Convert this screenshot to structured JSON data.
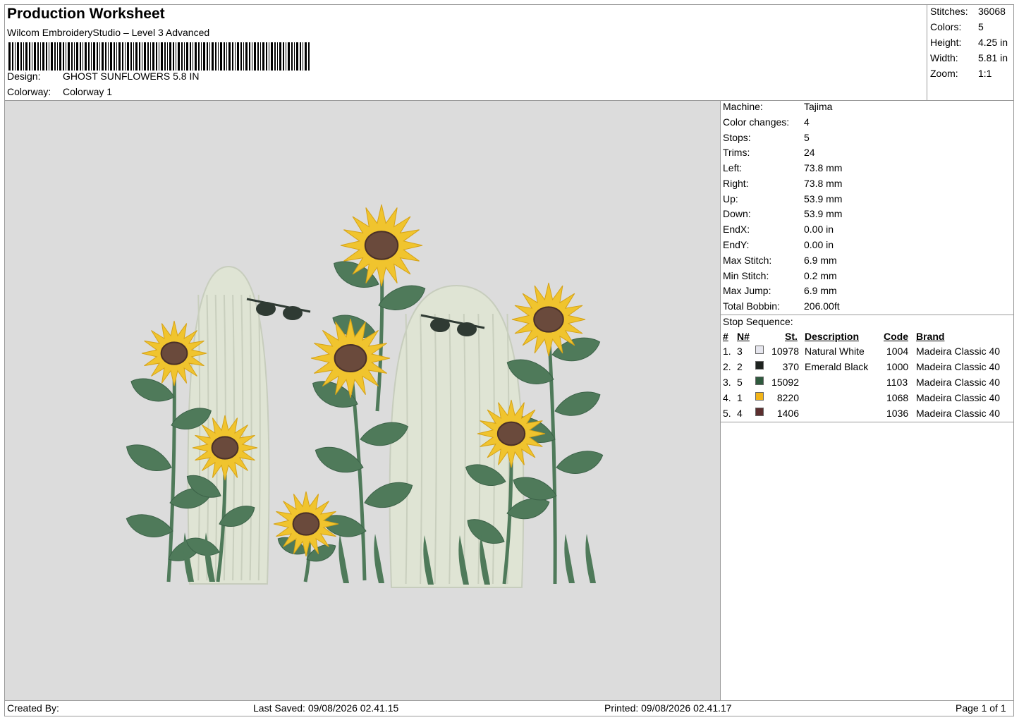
{
  "header": {
    "title": "Production Worksheet",
    "software": "Wilcom EmbroideryStudio – Level 3 Advanced",
    "design_label": "Design:",
    "design_value": "GHOST SUNFLOWERS 5.8 IN",
    "colorway_label": "Colorway:",
    "colorway_value": "Colorway 1"
  },
  "summary": [
    {
      "label": "Stitches:",
      "value": "36068"
    },
    {
      "label": "Colors:",
      "value": "5"
    },
    {
      "label": "Height:",
      "value": "4.25 in"
    },
    {
      "label": "Width:",
      "value": "5.81 in"
    },
    {
      "label": "Zoom:",
      "value": "1:1"
    }
  ],
  "machine_info": [
    {
      "label": "Machine:",
      "value": "Tajima"
    },
    {
      "label": "Color changes:",
      "value": "4"
    },
    {
      "label": "Stops:",
      "value": "5"
    },
    {
      "label": "Trims:",
      "value": "24"
    },
    {
      "label": "Left:",
      "value": "73.8 mm"
    },
    {
      "label": "Right:",
      "value": "73.8 mm"
    },
    {
      "label": "Up:",
      "value": "53.9 mm"
    },
    {
      "label": "Down:",
      "value": "53.9 mm"
    },
    {
      "label": "EndX:",
      "value": "0.00 in"
    },
    {
      "label": "EndY:",
      "value": "0.00 in"
    },
    {
      "label": "Max Stitch:",
      "value": "6.9 mm"
    },
    {
      "label": "Min Stitch:",
      "value": "0.2 mm"
    },
    {
      "label": "Max Jump:",
      "value": "6.9 mm"
    },
    {
      "label": "Total Bobbin:",
      "value": "206.00ft"
    }
  ],
  "stop_sequence": {
    "title": "Stop Sequence:",
    "headers": {
      "num": "#",
      "needle": "N#",
      "stitches": "St.",
      "description": "Description",
      "code": "Code",
      "brand": "Brand"
    },
    "rows": [
      {
        "num": "1.",
        "needle": "3",
        "color": "#e6e6ee",
        "stitches": "10978",
        "description": "Natural White",
        "code": "1004",
        "brand": "Madeira Classic 40"
      },
      {
        "num": "2.",
        "needle": "2",
        "color": "#1e2320",
        "stitches": "370",
        "description": "Emerald Black",
        "code": "1000",
        "brand": "Madeira Classic 40"
      },
      {
        "num": "3.",
        "needle": "5",
        "color": "#2f5a3e",
        "stitches": "15092",
        "description": "",
        "code": "1103",
        "brand": "Madeira Classic 40"
      },
      {
        "num": "4.",
        "needle": "1",
        "color": "#f2b418",
        "stitches": "8220",
        "description": "",
        "code": "1068",
        "brand": "Madeira Classic 40"
      },
      {
        "num": "5.",
        "needle": "4",
        "color": "#5c2f2f",
        "stitches": "1406",
        "description": "",
        "code": "1036",
        "brand": "Madeira Classic 40"
      }
    ]
  },
  "footer": {
    "created_by": "Created By:",
    "last_saved": "Last Saved: 09/08/2026 02.41.15",
    "printed": "Printed: 09/08/2026 02.41.17",
    "page": "Page 1 of 1"
  },
  "design_colors": {
    "ghost": "#dfe4d4",
    "leaf": "#4f7a5a",
    "petal": "#f0c42e",
    "center": "#6a4a3c",
    "glasses": "#2f3a33",
    "canvas": "#dcdcdc"
  }
}
